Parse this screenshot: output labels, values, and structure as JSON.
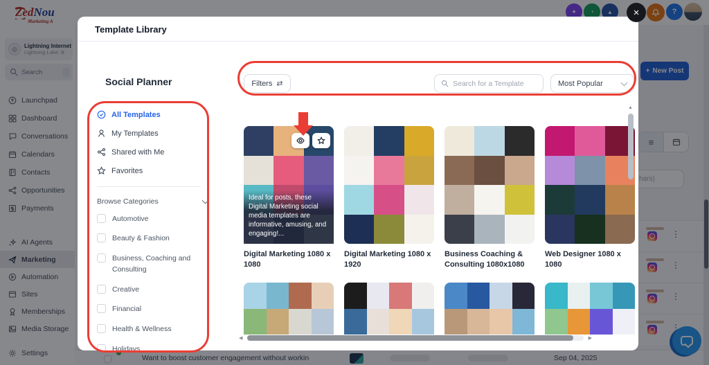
{
  "colors": {
    "annotation_red": "#ea3d34",
    "accent_blue": "#2563eb",
    "new_post_blue": "#1d5cd3",
    "bell_orange": "#e8710a",
    "help_blue": "#1a73e8",
    "logo_red": "#b3261e",
    "logo_blue": "#1a3a8f"
  },
  "glyphs": {
    "close": "×",
    "kebab": "⋮",
    "list": "≡",
    "plus": "+",
    "help": "?",
    "sliders": "⇄",
    "up": "▲",
    "down": "▼",
    "left": "◀",
    "right": "▶"
  },
  "sidebar": {
    "logo_part1": "Zed",
    "logo_part2": "Nou",
    "logo_sub": "Marketing A",
    "account_name": "Lightning Internet",
    "account_sub": "Lightning Lake, B",
    "search_label": "Search",
    "items": [
      {
        "label": "Launchpad"
      },
      {
        "label": "Dashboard"
      },
      {
        "label": "Conversations"
      },
      {
        "label": "Calendars"
      },
      {
        "label": "Contacts"
      },
      {
        "label": "Opportunities"
      },
      {
        "label": "Payments"
      },
      {
        "label": "AI Agents"
      },
      {
        "label": "Marketing"
      },
      {
        "label": "Automation"
      },
      {
        "label": "Sites"
      },
      {
        "label": "Memberships"
      },
      {
        "label": "Media Storage"
      },
      {
        "label": "Settings"
      }
    ]
  },
  "page": {
    "new_post_label": "New Post",
    "search_fragment": "hars)",
    "bottom_text": "Want to boost customer engagement without workin",
    "bottom_date": "Sep 04, 2025"
  },
  "modal": {
    "title": "Template Library",
    "section_title": "Social Planner",
    "nav": [
      {
        "label": "All Templates"
      },
      {
        "label": "My Templates"
      },
      {
        "label": "Shared with Me"
      },
      {
        "label": "Favorites"
      }
    ],
    "browse_label": "Browse Categories",
    "categories": [
      "Automotive",
      "Beauty & Fashion",
      "Business, Coaching and Consulting",
      "Creative",
      "Financial",
      "Health & Wellness",
      "Holidays"
    ],
    "filters_label": "Filters",
    "search_placeholder": "Search for a Template",
    "sort_value": "Most Popular",
    "cards_row1": [
      {
        "title": "Digital Marketing 1080 x 1080",
        "overlay_text": "Ideal for posts, these Digital Marketing social media templates are informative, amusing, and engaging!...",
        "tiles": [
          "#2e3f63",
          "#e8b27d",
          "#27486b",
          "#e5e0d8",
          "#e55c7d",
          "#6a59a3",
          "#57b9c4",
          "#c04a6b",
          "#5d4d9e",
          "#8fa3cc",
          "#3a4a7d",
          "#aac9d4"
        ]
      },
      {
        "title": "Digital Marketing 1080 x 1920",
        "tiles": [
          "#f2efe9",
          "#243d62",
          "#d9a929",
          "#f5f3f0",
          "#e8799a",
          "#c9a43e",
          "#9fd8e2",
          "#d64f86",
          "#f0e6ea",
          "#1d2f55",
          "#8a8a3a",
          "#f5f2ec"
        ]
      },
      {
        "title": "Business Coaching & Consulting 1080x1080",
        "tiles": [
          "#efe9db",
          "#bcd8e4",
          "#2b2b2b",
          "#8a6a55",
          "#6b4f40",
          "#caa88e",
          "#c0ae9e",
          "#f6f4ef",
          "#cfc23a",
          "#3a3f4a",
          "#aab4bc",
          "#f2f2f0"
        ]
      },
      {
        "title": "Web Designer 1080 x 1080",
        "tiles": [
          "#c2186f",
          "#e05a9a",
          "#7a1535",
          "#b58ad8",
          "#7e93aa",
          "#e8825e",
          "#1c3a38",
          "#223a5e",
          "#b8824a",
          "#2a3560",
          "#17301f",
          "#8a6a50"
        ]
      }
    ],
    "cards_row2": [
      {
        "tiles": [
          "#a9d3e6",
          "#79b7cf",
          "#b06a50",
          "#e7cfb7",
          "#8ab878",
          "#c7a877",
          "#d8d8d0",
          "#b7c7d7"
        ]
      },
      {
        "tiles": [
          "#1c1c1c",
          "#e8e8f0",
          "#d87878",
          "#f0efee",
          "#3a6a9a",
          "#e8e0d8",
          "#efd7b7",
          "#a7c7df"
        ]
      },
      {
        "tiles": [
          "#4a88c8",
          "#2858a0",
          "#c7d7e7",
          "#282838",
          "#b89878",
          "#d7b797",
          "#e7c7a7",
          "#7fb7d7"
        ]
      },
      {
        "tiles": [
          "#38b8c8",
          "#e8f0f0",
          "#77c7d7",
          "#3797b7",
          "#8fc78f",
          "#e79737",
          "#6757d7",
          "#efeff7"
        ]
      }
    ]
  }
}
